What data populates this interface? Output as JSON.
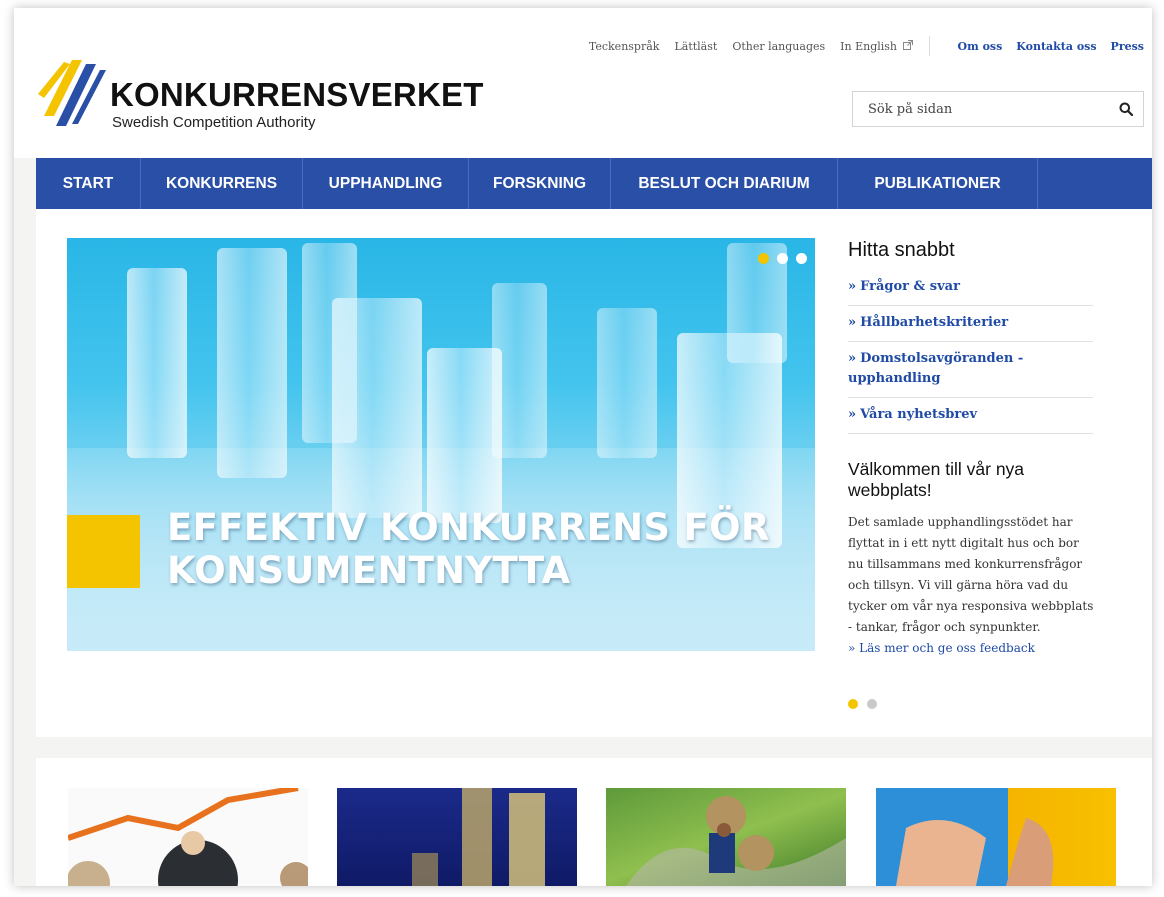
{
  "header": {
    "logo": {
      "name": "KONKURRENSVERKET",
      "subtitle": "Swedish Competition Authority"
    },
    "utility_links": [
      {
        "label": "Teckenspråk"
      },
      {
        "label": "Lättläst"
      },
      {
        "label": "Other languages"
      },
      {
        "label": "In English",
        "icon": "external-link-icon"
      }
    ],
    "main_links": [
      {
        "label": "Om oss"
      },
      {
        "label": "Kontakta oss"
      },
      {
        "label": "Press"
      }
    ],
    "search": {
      "placeholder": "Sök på sidan",
      "icon": "search-icon"
    }
  },
  "nav": {
    "items": [
      {
        "label": "START"
      },
      {
        "label": "KONKURRENS"
      },
      {
        "label": "UPPHANDLING"
      },
      {
        "label": "FORSKNING"
      },
      {
        "label": "BESLUT OCH DIARIUM"
      },
      {
        "label": "PUBLIKATIONER"
      }
    ]
  },
  "hero": {
    "title": "EFFEKTIV KONKURRENS FÖR KONSUMENTNYTTA",
    "slides": 3,
    "active_slide": 1
  },
  "quick_links": {
    "title": "Hitta snabbt",
    "items": [
      {
        "label": "Frågor & svar"
      },
      {
        "label": "Hållbarhetskriterier"
      },
      {
        "label": "Domstolsavgöranden - upphandling"
      },
      {
        "label": "Våra nyhetsbrev"
      }
    ]
  },
  "welcome": {
    "title": "Välkommen till vår nya webbplats!",
    "body": "Det samlade upphandlingsstödet har flyttat in i ett nytt digitalt hus och bor nu tillsammans med konkurrensfrågor och tillsyn. Vi vill gärna höra vad du tycker om vår nya responsiva webbplats - tankar, frågor och synpunkter.",
    "link": "Läs mer och ge oss feedback",
    "slides": 2,
    "active_slide": 1
  },
  "colors": {
    "brand_blue": "#2a4fa6",
    "link_blue": "#1f4aa5",
    "accent_yellow": "#f4c400"
  }
}
